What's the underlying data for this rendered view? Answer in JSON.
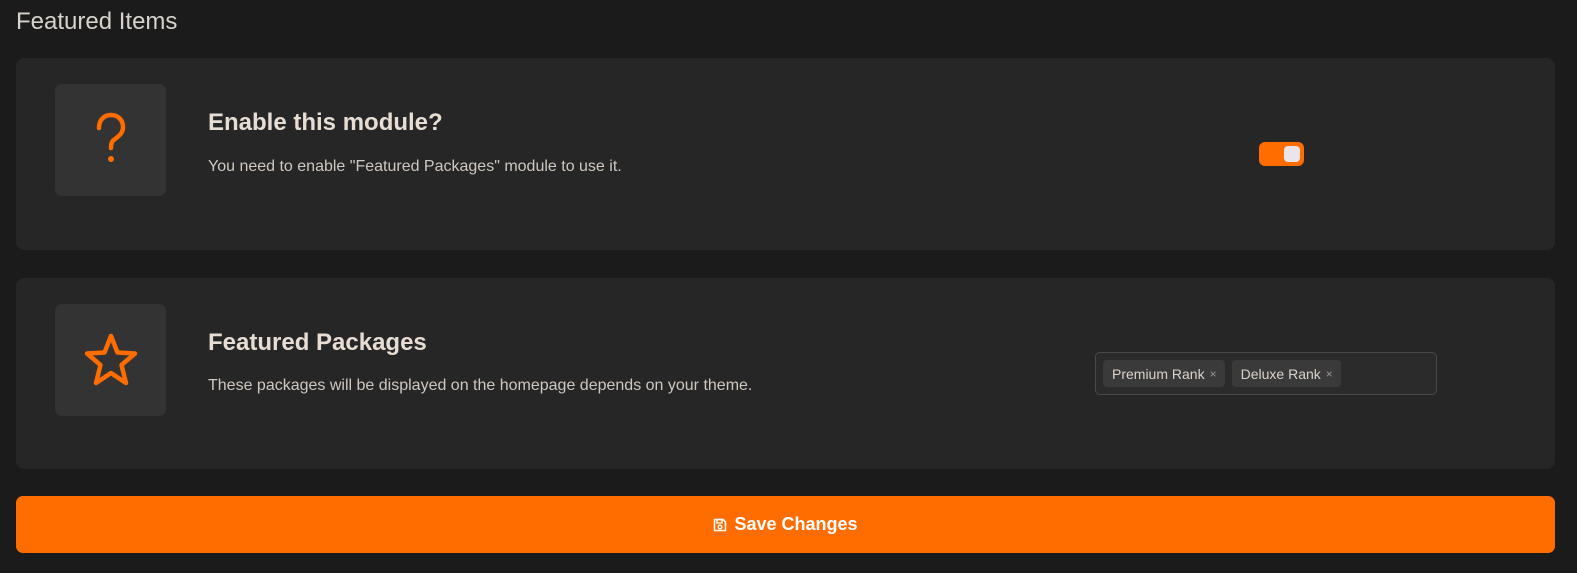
{
  "page": {
    "title": "Featured Items"
  },
  "colors": {
    "accent": "#ff6c00",
    "card_bg": "#262626",
    "icon_bg": "#333333",
    "page_bg": "#1b1b1b"
  },
  "module_card": {
    "icon": "question-mark-icon",
    "heading": "Enable this module?",
    "description": "You need to enable \"Featured Packages\" module to use it.",
    "toggle_enabled": true
  },
  "packages_card": {
    "icon": "star-icon",
    "heading": "Featured Packages",
    "description": "These packages will be displayed on the homepage depends on your theme.",
    "selected_tags": [
      {
        "label": "Premium Rank",
        "remove_glyph": "×"
      },
      {
        "label": "Deluxe Rank",
        "remove_glyph": "×"
      }
    ]
  },
  "save": {
    "label": "Save Changes",
    "icon": "floppy-disk-icon"
  }
}
